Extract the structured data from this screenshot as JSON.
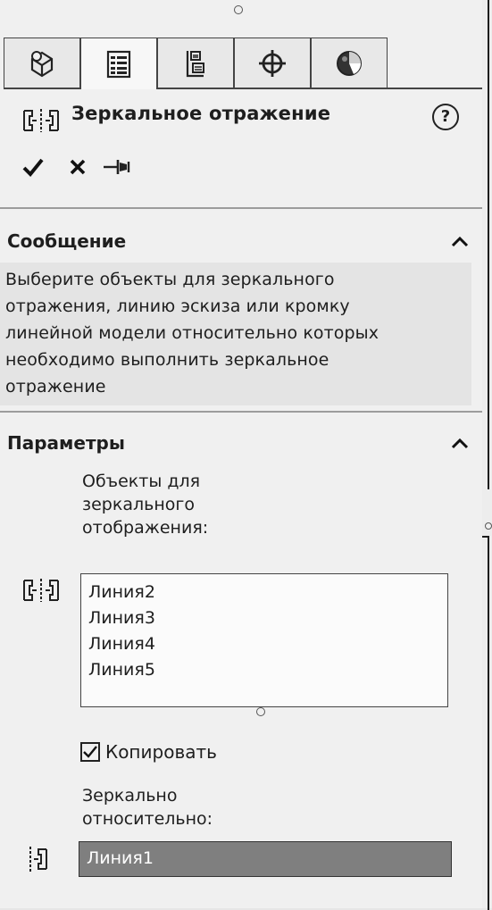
{
  "tabs": [
    {
      "icon": "feature-manager-icon",
      "active": false
    },
    {
      "icon": "property-manager-icon",
      "active": true
    },
    {
      "icon": "configuration-manager-icon",
      "active": false
    },
    {
      "icon": "dimxpert-manager-icon",
      "active": false
    },
    {
      "icon": "display-manager-icon",
      "active": false
    }
  ],
  "header": {
    "title": "Зеркальное отражение",
    "help_icon_glyph": "?"
  },
  "actions": [
    {
      "icon": "ok-checkmark-icon"
    },
    {
      "icon": "cancel-x-icon"
    },
    {
      "icon": "pushpin-icon"
    }
  ],
  "message_section": {
    "title": "Сообщение",
    "lines": [
      "Выберите объекты для зеркального",
      "отражения, линию эскиза или кромку",
      "линейной модели относительно которых",
      "необходимо выполнить зеркальное",
      "отражение"
    ]
  },
  "params_section": {
    "title": "Параметры",
    "entities_label_lines": [
      "Объекты для",
      "зеркального",
      "отображения:"
    ],
    "entities": [
      "Линия2",
      "Линия3",
      "Линия4",
      "Линия5"
    ],
    "copy_label": "Копировать",
    "copy_checked": true,
    "mirror_about_label_lines": [
      "Зеркально",
      "относительно:"
    ],
    "mirror_about_value": "Линия1"
  },
  "colors": {
    "panel": "#f0f0f0",
    "message_bg": "#e4e4e4",
    "selected_field": "#7f7f7f"
  }
}
